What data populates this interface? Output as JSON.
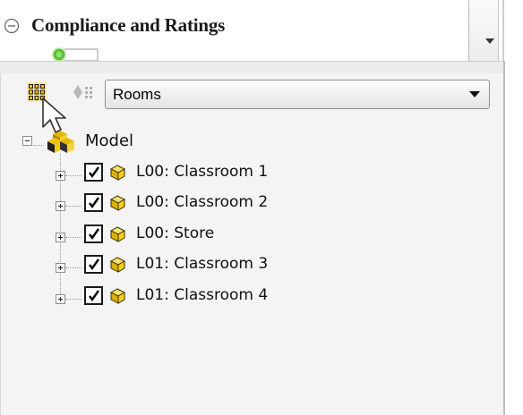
{
  "compliance": {
    "title": "Compliance and Ratings",
    "collapse_icon": "collapse-circle-icon",
    "toggle_state": "on"
  },
  "toolbar": {
    "grid_view_icon": "grid-view-icon",
    "group_icon": "group-by-icon",
    "view_select": {
      "selected": "Rooms"
    }
  },
  "tree": {
    "root": {
      "label": "Model",
      "expanded": true,
      "icon": "model-icon"
    },
    "items": [
      {
        "label": "L00: Classroom 1",
        "checked": true,
        "icon": "room-icon"
      },
      {
        "label": "L00: Classroom 2",
        "checked": true,
        "icon": "room-icon"
      },
      {
        "label": "L00: Store",
        "checked": true,
        "icon": "room-icon"
      },
      {
        "label": "L01: Classroom 3",
        "checked": true,
        "icon": "room-icon"
      },
      {
        "label": "L01: Classroom 4",
        "checked": true,
        "icon": "room-icon"
      }
    ]
  },
  "colors": {
    "toggle_accent": "#5cbf3a",
    "grid_icon": "#f2c200",
    "room_icon": "#f3d11a"
  }
}
